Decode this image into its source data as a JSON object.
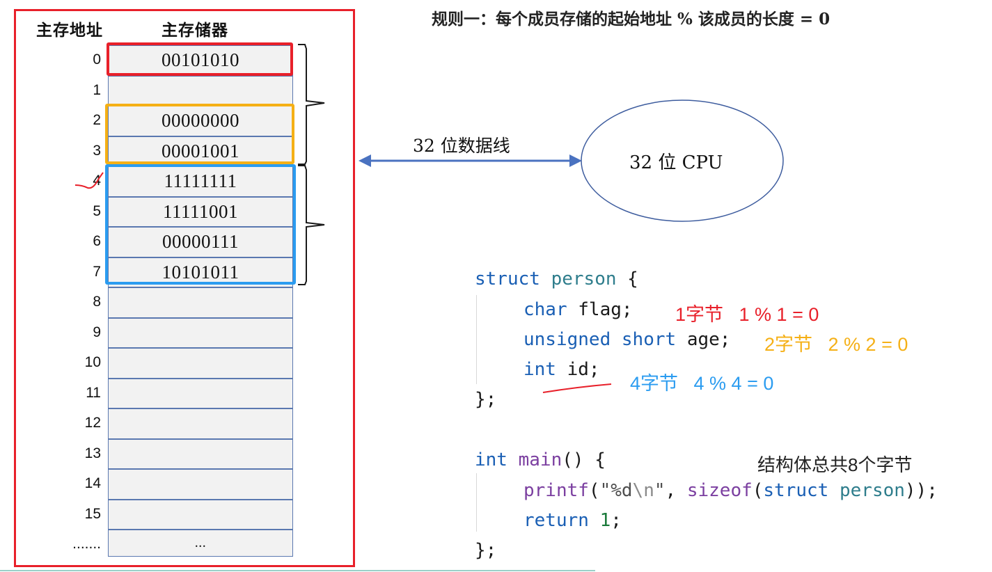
{
  "memory": {
    "address_header": "主存地址",
    "storage_header": "主存储器",
    "rows": [
      {
        "address": "0",
        "value": "00101010"
      },
      {
        "address": "1",
        "value": ""
      },
      {
        "address": "2",
        "value": "00000000"
      },
      {
        "address": "3",
        "value": "00001001"
      },
      {
        "address": "4",
        "value": "11111111"
      },
      {
        "address": "5",
        "value": "11111001"
      },
      {
        "address": "6",
        "value": "00000111"
      },
      {
        "address": "7",
        "value": "10101011"
      },
      {
        "address": "8",
        "value": ""
      },
      {
        "address": "9",
        "value": ""
      },
      {
        "address": "10",
        "value": ""
      },
      {
        "address": "11",
        "value": ""
      },
      {
        "address": "12",
        "value": ""
      },
      {
        "address": "13",
        "value": ""
      },
      {
        "address": "14",
        "value": ""
      },
      {
        "address": "15",
        "value": ""
      },
      {
        "address": ".......",
        "value": "..."
      }
    ]
  },
  "rule": "规则一：每个成员存储的起始地址 % 该成员的长度 = 0",
  "bus": {
    "label": "32 位数据线"
  },
  "cpu": {
    "label": "32 位 CPU"
  },
  "code": {
    "struct_kw": "struct",
    "struct_name": "person",
    "open_brace": " {",
    "line_flag_type": "char",
    "line_flag_rest": " flag;",
    "line_age_kw1": "unsigned",
    "line_age_kw2": "short",
    "line_age_rest": " age;",
    "line_id_type": "int",
    "line_id_rest": " id;",
    "close1": "};",
    "main_type": "int",
    "main_name": "main",
    "main_rest": "() {",
    "printf_fn": "printf",
    "printf_open": "(",
    "printf_str1": "\"%d",
    "printf_esc": "\\n",
    "printf_str2": "\"",
    "printf_comma": ", ",
    "sizeof_fn": "sizeof",
    "sizeof_open": "(",
    "sizeof_struct": "struct",
    "sizeof_name": "person",
    "printf_close": "));",
    "return_kw": "return",
    "return_val": "1",
    "return_semi": ";",
    "close2": "};"
  },
  "annotations": {
    "flag": "1字节   1 % 1 = 0",
    "age": "2字节   2 % 2 = 0",
    "id": "4字节   4 % 4 = 0",
    "total": "结构体总共8个字节"
  },
  "colors": {
    "red": "#e8202a",
    "orange": "#f5b016",
    "blue": "#2b9cf0",
    "arrow": "#4a72c0"
  }
}
